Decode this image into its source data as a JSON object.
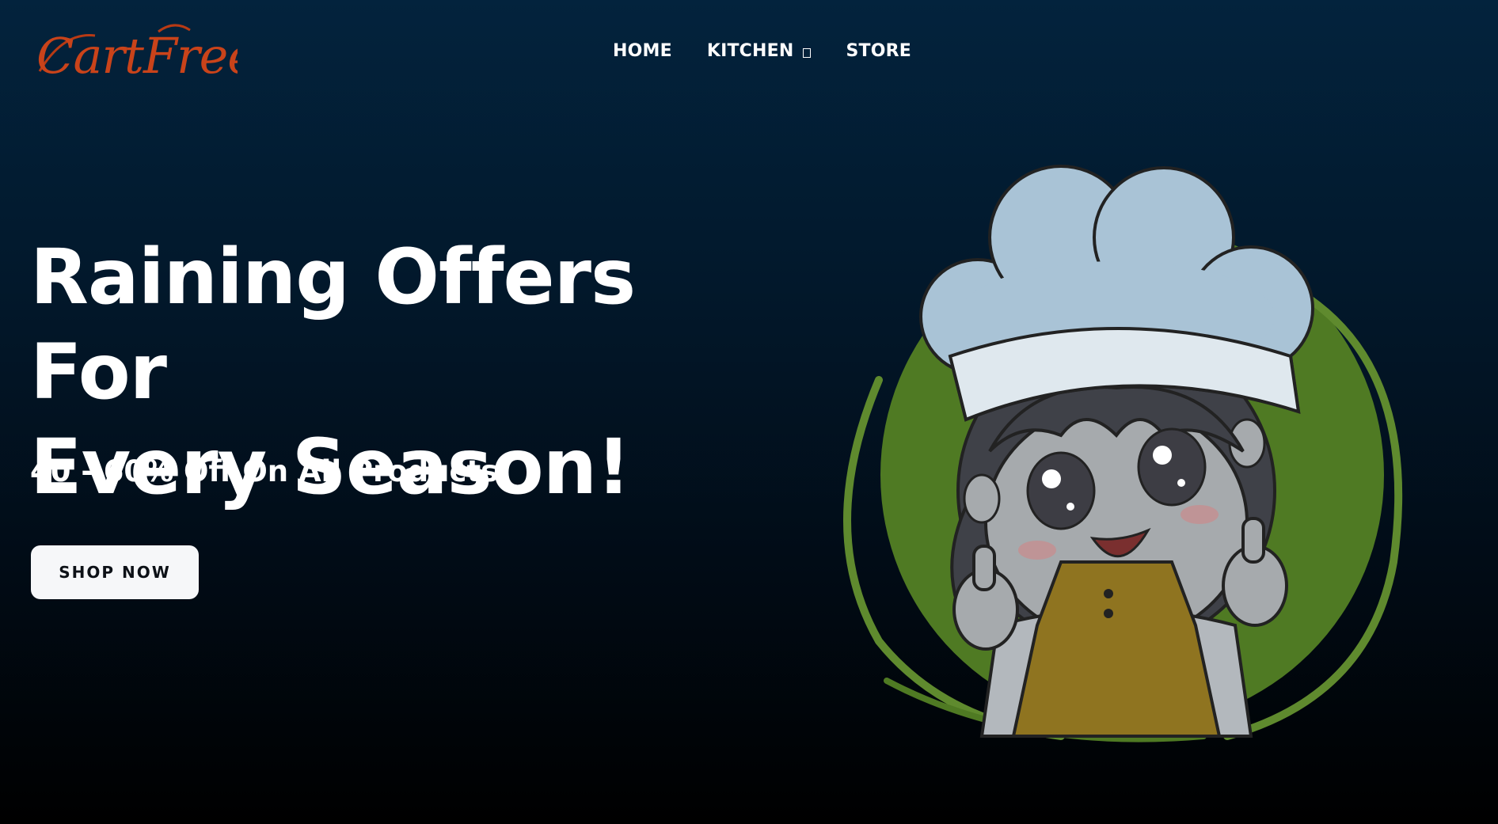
{
  "brand": {
    "logo_text": "CartFree",
    "logo_color": "#c9431a"
  },
  "nav": {
    "items": [
      {
        "label": "HOME"
      },
      {
        "label": "KITCHEN",
        "has_dropdown": true
      },
      {
        "label": "STORE"
      }
    ]
  },
  "hero": {
    "title_line1": "Raining Offers For",
    "title_line2": "Every Season!",
    "subtitle": "40 - 60% Off On All Products",
    "cta_label": "SHOP NOW"
  },
  "colors": {
    "background_top": "#03233d",
    "background_bottom": "#000000",
    "accent_green": "#5f8a2e",
    "apron": "#c48d22",
    "chef_hat": "#a9c3d6"
  },
  "illustration": {
    "icon": "chef-mascot-icon"
  }
}
